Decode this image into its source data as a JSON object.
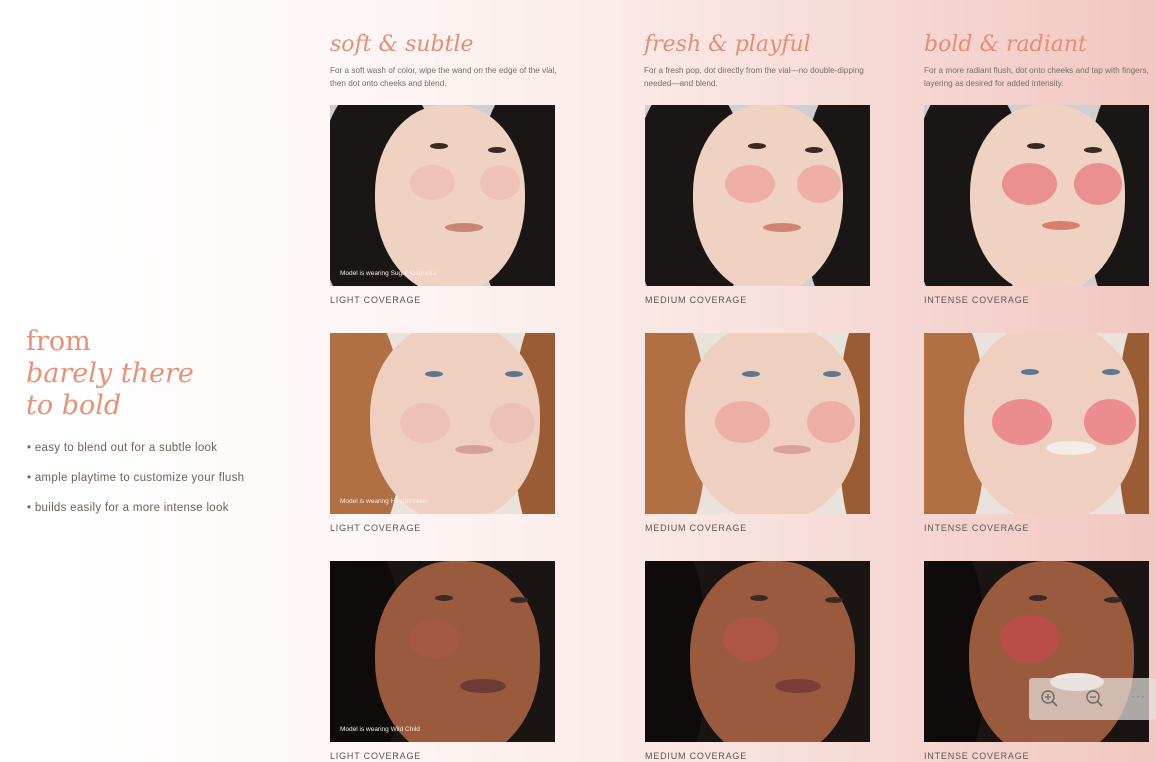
{
  "hero": {
    "line1": "from",
    "line2": "barely there",
    "line3": "to bold"
  },
  "bullets": [
    "easy to blend out for a subtle look",
    "ample playtime to customize your flush",
    "builds easily for a more intense look"
  ],
  "columns": [
    {
      "title": "soft & subtle",
      "description": "For a soft wash of color, wipe the wand on the edge of the vial, then dot onto cheeks and blend.",
      "coverage": "LIGHT COVERAGE"
    },
    {
      "title": "fresh & playful",
      "description": "For a fresh pop, dot directly from the vial—no double-dipping needed—and blend.",
      "coverage": "MEDIUM COVERAGE"
    },
    {
      "title": "bold & radiant",
      "description": "For a more radiant flush, dot onto cheeks and tap with fingers, layering as desired for added intensity.",
      "coverage": "INTENSE COVERAGE"
    }
  ],
  "model_captions": [
    "Model is wearing Sugar Magnolia",
    "Model is wearing Heartbreaker",
    "Model is wearing Wild Child"
  ],
  "toolbar": {
    "zoom_in_icon": "zoom-in-icon",
    "zoom_out_icon": "zoom-out-icon",
    "more_label": "···"
  },
  "colors": {
    "accent": "#e58e76",
    "text": "#6f5f58"
  }
}
